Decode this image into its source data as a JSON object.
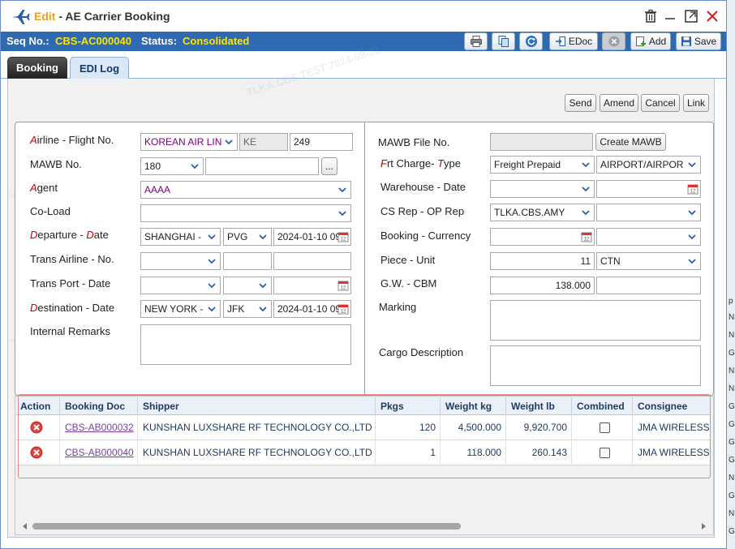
{
  "window": {
    "edit_label": "Edit",
    "title_rest": " - AE Carrier Booking"
  },
  "seqbar": {
    "seq_label": "Seq No.:",
    "seq_value": "CBS-AC000040",
    "status_label": "Status:",
    "status_value": "Consolidated",
    "edoc_label": "EDoc",
    "add_label": "Add",
    "save_label": "Save"
  },
  "tabs": [
    {
      "label": "Booking"
    },
    {
      "label": "EDI Log"
    }
  ],
  "actions": {
    "send": "Send",
    "amend": "Amend",
    "cancel": "Cancel",
    "link": "Link"
  },
  "left_form": {
    "airline_label_r": "A",
    "airline_label_rest": "irline - Flight No.",
    "airline_value": "KOREAN AIR LIN",
    "airline_code": "KE",
    "flight_no": "249",
    "mawb_label": "MAWB No.",
    "mawb_prefix": "180",
    "mawb_no": "",
    "ellipsis": "...",
    "agent_label_r": "A",
    "agent_label_rest": "gent",
    "agent_value": "AAAA",
    "coload_label": "Co-Load",
    "coload_value": "",
    "departure_label_r1": "D",
    "departure_label_mid": "eparture - ",
    "departure_label_r2": "D",
    "departure_label_end": "ate",
    "departure_city": "SHANGHAI -",
    "departure_code": "PVG",
    "departure_date": "2024-01-10 09:0",
    "trans_airline_label": "Trans Airline - No.",
    "trans_port_label": "Trans Port - Date",
    "destination_label_r": "D",
    "destination_label_rest": "estination - Date",
    "destination_city": "NEW YORK -",
    "destination_code": "JFK",
    "destination_date": "2024-01-10 09:0",
    "internal_remarks_label": "Internal Remarks"
  },
  "right_form": {
    "mawb_file_label": "MAWB File No.",
    "create_mawb": "Create MAWB",
    "frt_label_r1": "F",
    "frt_label_mid": "rt Charge- ",
    "frt_label_r2": "T",
    "frt_label_end": "ype",
    "frt_value": "Freight Prepaid",
    "frt_type_value": "AIRPORT/AIRPOR",
    "warehouse_label": "Warehouse - Date",
    "cs_rep_label": "CS Rep - OP Rep",
    "cs_rep_value": "TLKA.CBS.AMY",
    "booking_label": "Booking - Currency",
    "piece_label": "Piece - Unit",
    "piece_value": "11",
    "unit_value": "CTN",
    "gw_label": "G.W. - CBM",
    "gw_value": "138.000",
    "marking_label": "Marking",
    "cargo_desc_label": "Cargo Description"
  },
  "grid": {
    "headers": [
      "Action",
      "Booking Doc",
      "Shipper",
      "Pkgs",
      "Weight kg",
      "Weight lb",
      "Combined",
      "Consignee"
    ],
    "rows": [
      {
        "doc": "CBS-AB000032",
        "shipper": "KUNSHAN LUXSHARE RF TECHNOLOGY CO.,LTD",
        "pkgs": "120",
        "kg": "4,500.000",
        "lb": "9,920.700",
        "consignee": "JMA WIRELESS",
        "combined": false
      },
      {
        "doc": "CBS-AB000040",
        "shipper": "KUNSHAN LUXSHARE RF TECHNOLOGY CO.,LTD",
        "pkgs": "1",
        "kg": "118.000",
        "lb": "260.143",
        "consignee": "JMA WIRELESS",
        "combined": false
      }
    ]
  },
  "background_letters": [
    "p",
    "N",
    "N",
    "G",
    "N",
    "N",
    "G",
    "G",
    "G",
    "G",
    "N",
    "G",
    "N",
    "G"
  ],
  "watermark": "TLKA.CBS.TEST 2024-08-21",
  "colors": {
    "seqbar_bg": "#2d6ab1",
    "accent_yellow": "#ffe600",
    "edit_orange": "#f0a11a",
    "required_red": "#c00000"
  },
  "icons": [
    "airplane-icon",
    "trash-icon",
    "minimize-icon",
    "maximize-icon",
    "close-icon",
    "print-icon",
    "copy-icon",
    "refresh-icon",
    "edoc-icon",
    "cancel-circle-icon",
    "add-icon",
    "save-icon",
    "chevron-down-icon",
    "calendar-icon",
    "delete-row-icon"
  ]
}
